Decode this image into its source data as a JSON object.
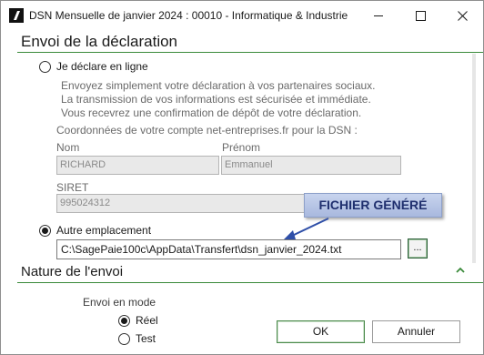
{
  "window": {
    "title": "DSN Mensuelle de janvier 2024 : 00010 - Informatique & Industrie"
  },
  "section_envoi": {
    "title": "Envoi de la déclaration"
  },
  "online_option": {
    "label": "Je déclare en ligne",
    "selected": false,
    "description": "Envoyez simplement votre déclaration à vos partenaires sociaux. La transmission de vos informations est sécurisée et immédiate. Vous recevrez une confirmation de dépôt de votre déclaration.",
    "account_heading": "Coordonnées de votre compte net-entreprises.fr pour la DSN :",
    "nom_label": "Nom",
    "nom_value": "RICHARD",
    "prenom_label": "Prénom",
    "prenom_value": "Emmanuel",
    "siret_label": "SIRET",
    "siret_value": "995024312"
  },
  "other_location_option": {
    "label": "Autre emplacement",
    "selected": true,
    "path_value": "C:\\SagePaie100c\\AppData\\Transfert\\dsn_janvier_2024.txt",
    "browse_label": "..."
  },
  "annotation": {
    "callout_text": "FICHIER GÉNÉRÉ"
  },
  "section_nature": {
    "title": "Nature de l'envoi",
    "mode_label": "Envoi en mode",
    "options": [
      {
        "label": "Réel",
        "selected": true
      },
      {
        "label": "Test",
        "selected": false
      }
    ]
  },
  "buttons": {
    "ok": "OK",
    "cancel": "Annuler"
  },
  "colors": {
    "accent_green": "#3a8a3a",
    "callout_blue": "#1f2f6e",
    "arrow_blue": "#2f4fa8"
  }
}
